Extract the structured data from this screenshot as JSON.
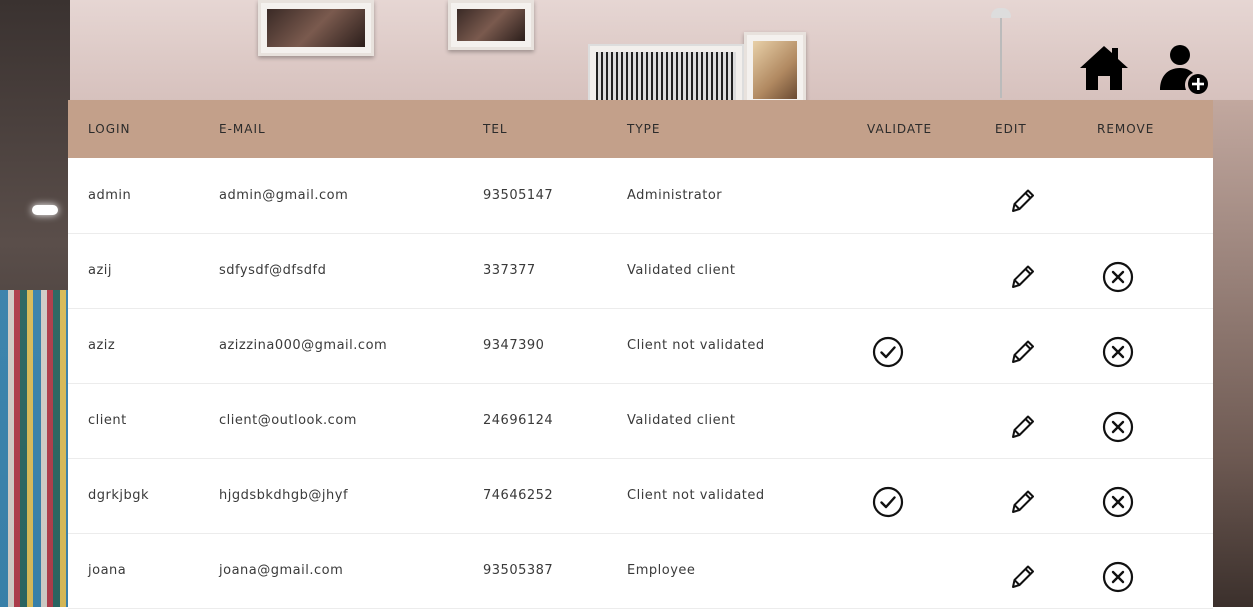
{
  "nav": {
    "home_icon": "home-icon",
    "add_user_icon": "user-plus-icon"
  },
  "table": {
    "headers": {
      "login": "LOGIN",
      "email": "E-MAIL",
      "tel": "TEL",
      "type": "TYPE",
      "validate": "VALIDATE",
      "edit": "EDIT",
      "remove": "REMOVE"
    },
    "rows": [
      {
        "login": "admin",
        "email": "admin@gmail.com",
        "tel": "93505147",
        "type": "Administrator",
        "can_validate": false,
        "can_edit": true,
        "can_remove": false
      },
      {
        "login": "azij",
        "email": "sdfysdf@dfsdfd",
        "tel": "337377",
        "type": "Validated client",
        "can_validate": false,
        "can_edit": true,
        "can_remove": true
      },
      {
        "login": "aziz",
        "email": "azizzina000@gmail.com",
        "tel": "9347390",
        "type": "Client not validated",
        "can_validate": true,
        "can_edit": true,
        "can_remove": true
      },
      {
        "login": "client",
        "email": "client@outlook.com",
        "tel": "24696124",
        "type": "Validated client",
        "can_validate": false,
        "can_edit": true,
        "can_remove": true
      },
      {
        "login": "dgrkjbgk",
        "email": "hjgdsbkdhgb@jhyf",
        "tel": "74646252",
        "type": "Client not validated",
        "can_validate": true,
        "can_edit": true,
        "can_remove": true
      },
      {
        "login": "joana",
        "email": "joana@gmail.com",
        "tel": "93505387",
        "type": "Employee",
        "can_validate": false,
        "can_edit": true,
        "can_remove": true
      }
    ]
  },
  "icons": {
    "validate": "check-circle-icon",
    "edit": "pencil-icon",
    "remove": "x-circle-icon"
  },
  "colors": {
    "header_bg": "#c3a08a",
    "row_bg": "#ffffff",
    "icon": "#111111"
  }
}
